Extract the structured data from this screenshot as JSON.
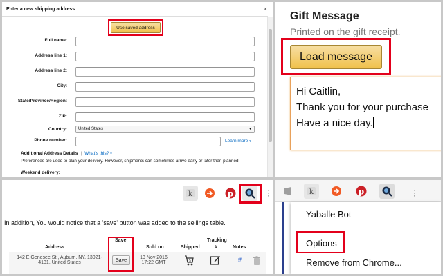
{
  "shipping_form": {
    "title": "Enter a new shipping address",
    "close": "×",
    "use_saved_label": "Use saved address",
    "fields": [
      {
        "label": "Full name:"
      },
      {
        "label": "Address line 1:"
      },
      {
        "label": "Address line 2:"
      },
      {
        "label": "City:"
      },
      {
        "label": "State/Province/Region:"
      },
      {
        "label": "ZIP:"
      }
    ],
    "country_label": "Country:",
    "country_value": "United States",
    "phone_label": "Phone number:",
    "learn_more": "Learn more",
    "additional_title": "Additional Address Details",
    "separator": "|",
    "whats_this": "What's this?",
    "preferences_text": "Preferences are used to plan your delivery. However, shipments can sometimes arrive early or later than planned.",
    "weekend_label": "Weekend delivery:"
  },
  "gift_message": {
    "title": "Gift Message",
    "subtitle": "Printed on the gift receipt.",
    "load_button": "Load message",
    "lines": [
      "Hi Caitlin,",
      "Thank you for your purchase",
      "Have a nice day."
    ]
  },
  "sellings": {
    "intro": "In addition, You would notice that a 'save' button was added to the sellings table.",
    "headers": {
      "address": "Address",
      "save": "Save",
      "sold_on": "Sold on",
      "shipped": "Shipped",
      "tracking_1": "Tracking",
      "tracking_2": "#",
      "notes": "Notes"
    },
    "row": {
      "address_1": "142 E Genesee St , Auburn, NY, 13021-",
      "address_2": "4131, United States",
      "save_button": "Save",
      "sold_date": "13 Nov 2016",
      "sold_time": "17:22 GMT",
      "notes_link": "#"
    }
  },
  "context_menu": {
    "items": [
      "Yaballe Bot",
      "Options",
      "Remove from Chrome..."
    ]
  },
  "colors": {
    "highlight": "#e3001b",
    "amazon_button": "#f0c14b",
    "link": "#0066c0",
    "pinterest": "#cb2027"
  }
}
